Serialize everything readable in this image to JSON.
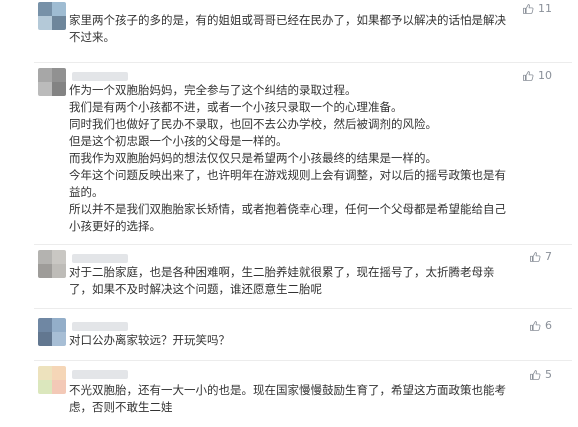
{
  "comments": [
    {
      "likes": "11",
      "lines": [
        "家里两个孩子的多的是，有的姐姐或哥哥已经在民办了，如果都予以解决的话怕是解决",
        "不过来。"
      ],
      "avatar_colors": [
        "#4a6d8c",
        "#7fa6c4",
        "#9cb7cc",
        "#3e5e7a"
      ]
    },
    {
      "likes": "10",
      "lines": [
        "作为一个双胞胎妈妈，完全参与了这个纠结的录取过程。",
        "我们是有两个小孩都不进，或者一个小孩只录取一个的心理准备。",
        "同时我们也做好了民办不录取，也回不去公办学校，然后被调剂的风险。",
        "但是这个初忠跟一个小孩的父母是一样的。",
        "而我作为双胞胎妈妈的想法仅仅只是希望两个小孩最终的结果是一样的。",
        "今年这个问题反映出来了，也许明年在游戏规则上会有调整，对以后的摇号政策也是有",
        "益的。",
        "所以并不是我们双胞胎家长矫情，或者抱着侥幸心理，任何一个父母都是希望能给自己",
        "小孩更好的选择。"
      ],
      "avatar_colors": [
        "#8a8a8a",
        "#6d6d6d",
        "#a5a5a5",
        "#5a5a5a"
      ]
    },
    {
      "likes": "7",
      "lines": [
        "对于二胎家庭，也是各种困难啊，生二胎养娃就很累了，现在摇号了，太折腾老母亲",
        "了，如果不及时解决这个问题，谁还愿意生二胎呢"
      ],
      "avatar_colors": [
        "#9c9a96",
        "#b8b5b0",
        "#7e7b77",
        "#a9a6a1"
      ]
    },
    {
      "likes": "6",
      "lines": [
        "对口公办离家较远？开玩笑吗？"
      ],
      "avatar_colors": [
        "#3f5f85",
        "#6f93b8",
        "#2e4a6b",
        "#8aa9c7"
      ]
    },
    {
      "likes": "5",
      "lines": [
        "不光双胞胎，还有一大一小的也是。现在国家慢慢鼓励生育了，希望这方面政策也能考",
        "虑，否则不敢生二娃"
      ],
      "avatar_colors": [
        "#e7d9a8",
        "#f2c9a0",
        "#cfe0a8",
        "#f0b8a0"
      ]
    }
  ]
}
